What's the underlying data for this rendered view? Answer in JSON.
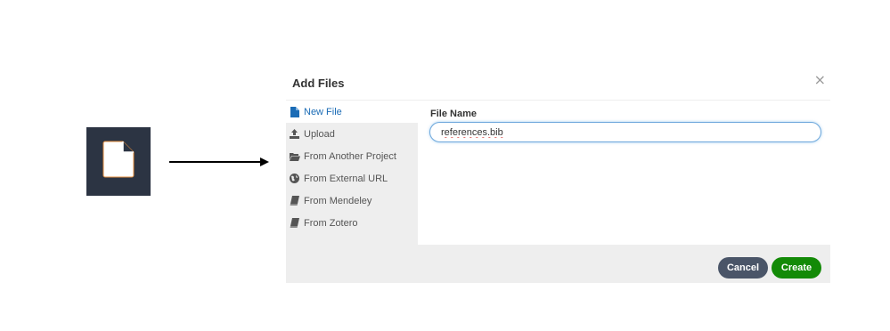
{
  "dialog": {
    "title": "Add Files",
    "close_glyph": "×"
  },
  "sidebar": {
    "items": [
      {
        "label": "New File",
        "icon": "file-icon",
        "active": true
      },
      {
        "label": "Upload",
        "icon": "upload-icon",
        "active": false
      },
      {
        "label": "From Another Project",
        "icon": "folder-open-icon",
        "active": false
      },
      {
        "label": "From External URL",
        "icon": "globe-icon",
        "active": false
      },
      {
        "label": "From Mendeley",
        "icon": "book-icon",
        "active": false
      },
      {
        "label": "From Zotero",
        "icon": "book-icon",
        "active": false
      }
    ]
  },
  "form": {
    "label": "File Name",
    "value": "references.bib"
  },
  "footer": {
    "cancel_label": "Cancel",
    "create_label": "Create"
  },
  "colors": {
    "accent": "#1a6bb5",
    "create": "#138a07",
    "cancel": "#4a5568",
    "tile": "#2c3443"
  }
}
